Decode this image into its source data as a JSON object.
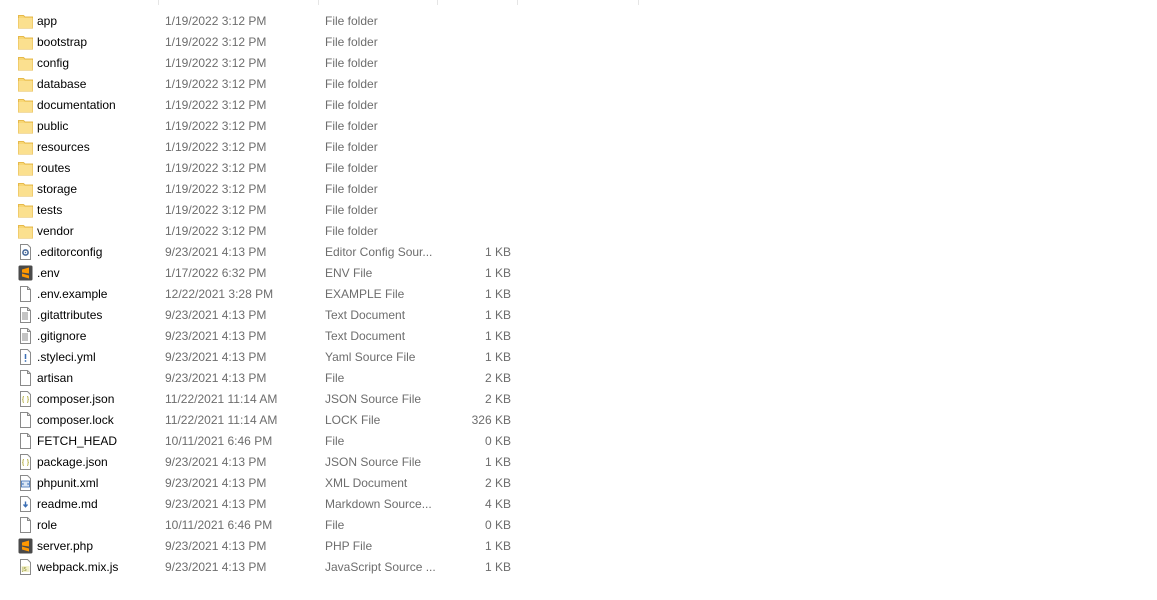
{
  "files": [
    {
      "name": "app",
      "date": "1/19/2022 3:12 PM",
      "type": "File folder",
      "size": "",
      "icon": "folder-icon"
    },
    {
      "name": "bootstrap",
      "date": "1/19/2022 3:12 PM",
      "type": "File folder",
      "size": "",
      "icon": "folder-icon"
    },
    {
      "name": "config",
      "date": "1/19/2022 3:12 PM",
      "type": "File folder",
      "size": "",
      "icon": "folder-icon"
    },
    {
      "name": "database",
      "date": "1/19/2022 3:12 PM",
      "type": "File folder",
      "size": "",
      "icon": "folder-icon"
    },
    {
      "name": "documentation",
      "date": "1/19/2022 3:12 PM",
      "type": "File folder",
      "size": "",
      "icon": "folder-icon"
    },
    {
      "name": "public",
      "date": "1/19/2022 3:12 PM",
      "type": "File folder",
      "size": "",
      "icon": "folder-icon"
    },
    {
      "name": "resources",
      "date": "1/19/2022 3:12 PM",
      "type": "File folder",
      "size": "",
      "icon": "folder-icon"
    },
    {
      "name": "routes",
      "date": "1/19/2022 3:12 PM",
      "type": "File folder",
      "size": "",
      "icon": "folder-icon"
    },
    {
      "name": "storage",
      "date": "1/19/2022 3:12 PM",
      "type": "File folder",
      "size": "",
      "icon": "folder-icon"
    },
    {
      "name": "tests",
      "date": "1/19/2022 3:12 PM",
      "type": "File folder",
      "size": "",
      "icon": "folder-icon"
    },
    {
      "name": "vendor",
      "date": "1/19/2022 3:12 PM",
      "type": "File folder",
      "size": "",
      "icon": "folder-icon"
    },
    {
      "name": ".editorconfig",
      "date": "9/23/2021 4:13 PM",
      "type": "Editor Config Sour...",
      "size": "1 KB",
      "icon": "config-file-icon"
    },
    {
      "name": ".env",
      "date": "1/17/2022 6:32 PM",
      "type": "ENV File",
      "size": "1 KB",
      "icon": "sublime-file-icon"
    },
    {
      "name": ".env.example",
      "date": "12/22/2021 3:28 PM",
      "type": "EXAMPLE File",
      "size": "1 KB",
      "icon": "blank-file-icon"
    },
    {
      "name": ".gitattributes",
      "date": "9/23/2021 4:13 PM",
      "type": "Text Document",
      "size": "1 KB",
      "icon": "text-file-icon"
    },
    {
      "name": ".gitignore",
      "date": "9/23/2021 4:13 PM",
      "type": "Text Document",
      "size": "1 KB",
      "icon": "text-file-icon"
    },
    {
      "name": ".styleci.yml",
      "date": "9/23/2021 4:13 PM",
      "type": "Yaml Source File",
      "size": "1 KB",
      "icon": "yaml-file-icon"
    },
    {
      "name": "artisan",
      "date": "9/23/2021 4:13 PM",
      "type": "File",
      "size": "2 KB",
      "icon": "blank-file-icon"
    },
    {
      "name": "composer.json",
      "date": "11/22/2021 11:14 AM",
      "type": "JSON Source File",
      "size": "2 KB",
      "icon": "json-file-icon"
    },
    {
      "name": "composer.lock",
      "date": "11/22/2021 11:14 AM",
      "type": "LOCK File",
      "size": "326 KB",
      "icon": "blank-file-icon"
    },
    {
      "name": "FETCH_HEAD",
      "date": "10/11/2021 6:46 PM",
      "type": "File",
      "size": "0 KB",
      "icon": "blank-file-icon"
    },
    {
      "name": "package.json",
      "date": "9/23/2021 4:13 PM",
      "type": "JSON Source File",
      "size": "1 KB",
      "icon": "json-file-icon"
    },
    {
      "name": "phpunit.xml",
      "date": "9/23/2021 4:13 PM",
      "type": "XML Document",
      "size": "2 KB",
      "icon": "xml-file-icon"
    },
    {
      "name": "readme.md",
      "date": "9/23/2021 4:13 PM",
      "type": "Markdown Source...",
      "size": "4 KB",
      "icon": "markdown-file-icon"
    },
    {
      "name": "role",
      "date": "10/11/2021 6:46 PM",
      "type": "File",
      "size": "0 KB",
      "icon": "blank-file-icon"
    },
    {
      "name": "server.php",
      "date": "9/23/2021 4:13 PM",
      "type": "PHP File",
      "size": "1 KB",
      "icon": "sublime-file-icon"
    },
    {
      "name": "webpack.mix.js",
      "date": "9/23/2021 4:13 PM",
      "type": "JavaScript Source ...",
      "size": "1 KB",
      "icon": "js-file-icon"
    }
  ],
  "colors": {
    "folder": "#f8d775",
    "folder_dark": "#e6b94b",
    "secondary_text": "#6d6d6d",
    "sublime": "#ff9800"
  }
}
